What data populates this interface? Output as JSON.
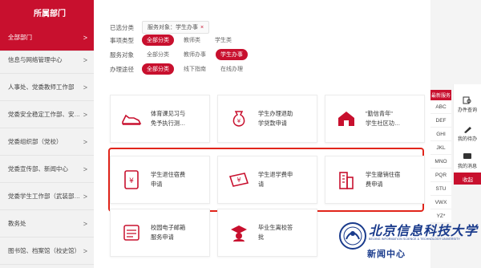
{
  "sidebar": {
    "title": "所属部门",
    "items": [
      {
        "label": "全部部门",
        "active": true
      },
      {
        "label": "信息与网络管理中心"
      },
      {
        "label": "人事处、党委教师工作部"
      },
      {
        "label": "党委安全稳定工作部、安…"
      },
      {
        "label": "党委组织部（党校）"
      },
      {
        "label": "党委宣传部、新闻中心"
      },
      {
        "label": "党委学生工作部（武装部…"
      },
      {
        "label": "教务处"
      },
      {
        "label": "图书馆、档案馆（校史馆）"
      }
    ]
  },
  "filters": {
    "selected": {
      "label": "已选分类",
      "chip": "服务对象：学生办事",
      "remove": "×"
    },
    "category": {
      "label": "事项类型",
      "options": [
        "全部分类",
        "教师类",
        "学生类"
      ]
    },
    "audience": {
      "label": "服务对象",
      "options": [
        "全部分类",
        "教师办事",
        "学生办事"
      ]
    },
    "channel": {
      "label": "办理途径",
      "options": [
        "全部分类",
        "线下指南",
        "在线办理"
      ]
    }
  },
  "cards": [
    {
      "title": "体育课见习与\n免予执行测…",
      "icon": "shoe-icon"
    },
    {
      "title": "学生办理退助\n学贷款申请",
      "icon": "money-bag-icon"
    },
    {
      "title": "\"勤信青年\"\n学生社区功…",
      "icon": "house-icon"
    },
    {
      "title": "学生退住宿费\n申请",
      "icon": "yen-card-icon"
    },
    {
      "title": "学生退学费申\n请",
      "icon": "yen-ticket-icon"
    },
    {
      "title": "学生撤销住宿\n费申请",
      "icon": "building-icon"
    },
    {
      "title": "校园电子邮箱\n服务申请",
      "icon": "mail-icon"
    },
    {
      "title": "毕业生离校答\n批",
      "icon": "graduate-icon"
    }
  ],
  "alphabet": {
    "header": "最新服务",
    "items": [
      "ABC",
      "DEF",
      "GHI",
      "JKL",
      "MNO",
      "PQR",
      "STU",
      "VWX",
      "YZ*"
    ]
  },
  "float_bar": {
    "items": [
      {
        "label": "办件查询",
        "icon": "search-doc-icon"
      },
      {
        "label": "我的待办",
        "icon": "pen-icon"
      },
      {
        "label": "我的消息",
        "icon": "message-icon"
      }
    ],
    "collapse": "收起"
  },
  "logo": {
    "cn": "北京信息科技大学",
    "en": "BEIJING INFORMATION SCIENCE & TECHNOLOGY UNIVERSITY",
    "sub": "新闻中心"
  },
  "colors": {
    "brand": "#c8102e",
    "highlight": "#e1251b",
    "logo": "#1a3b8c"
  }
}
